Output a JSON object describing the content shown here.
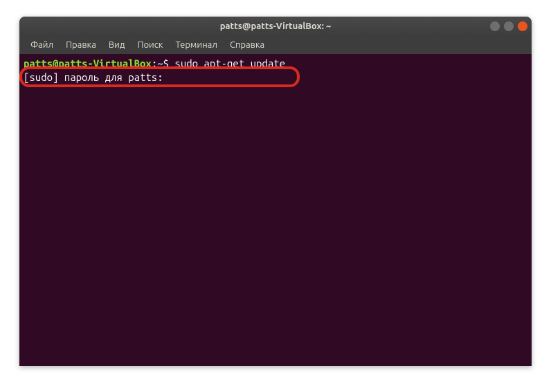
{
  "window": {
    "title": "patts@patts-VirtualBox: ~"
  },
  "menubar": {
    "items": [
      "Файл",
      "Правка",
      "Вид",
      "Поиск",
      "Терминал",
      "Справка"
    ]
  },
  "terminal": {
    "prompt_user": "patts@patts-VirtualBox",
    "prompt_colon": ":",
    "prompt_path": "~",
    "prompt_dollar": "$",
    "command": " sudo apt-get update",
    "output_line": "[sudo] пароль для patts: "
  },
  "icons": {
    "minimize": "–",
    "maximize": "□",
    "close": "×"
  }
}
